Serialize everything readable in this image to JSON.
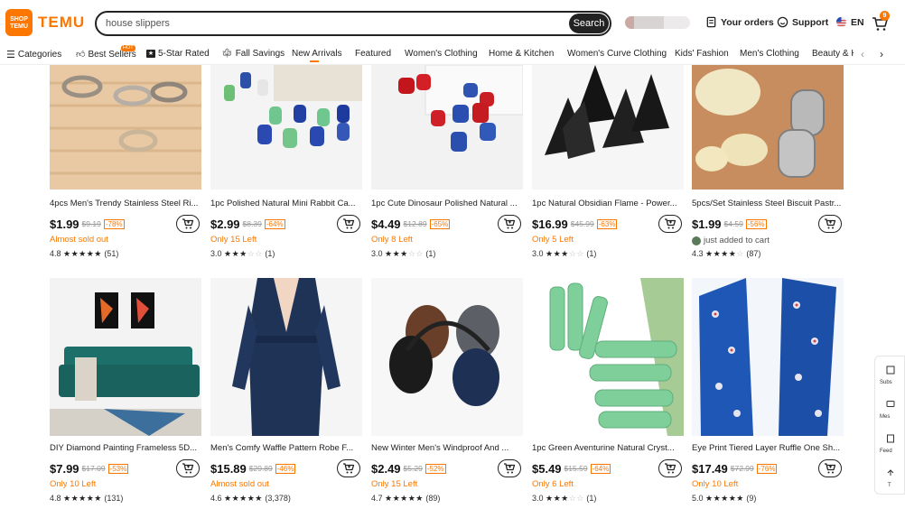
{
  "header": {
    "logo_badge": "SHOP TEMU",
    "logo_text": "TEMU",
    "search_value": "house slippers",
    "search_button": "Search",
    "your_orders": "Your orders",
    "support": "Support",
    "language": "EN",
    "cart_count": "9"
  },
  "nav": {
    "categories": "Categories",
    "best_sellers": "Best Sellers",
    "hot_badge": "HOT",
    "five_star": "5-Star Rated",
    "fall_savings": "Fall Savings",
    "new_arrivals": "New Arrivals",
    "featured": "Featured",
    "womens_clothing": "Women's Clothing",
    "home_kitchen": "Home & Kitchen",
    "womens_curve": "Women's Curve Clothing",
    "kids_fashion": "Kids' Fashion",
    "mens_clothing": "Men's Clothing",
    "beauty": "Beauty & H"
  },
  "products": [
    {
      "title": "4pcs Men's Trendy Stainless Steel Ri...",
      "price": "$1.99",
      "orig": "$9.19",
      "disc": "-78%",
      "status": "Almost sold out",
      "rating": "4.8",
      "full": 5,
      "reviews": "(51)"
    },
    {
      "title": "1pc Polished Natural Mini Rabbit Ca...",
      "price": "$2.99",
      "orig": "$8.39",
      "disc": "-64%",
      "status": "Only 15 Left",
      "rating": "3.0",
      "full": 3,
      "reviews": "(1)"
    },
    {
      "title": "1pc Cute Dinosaur Polished Natural ...",
      "price": "$4.49",
      "orig": "$12.89",
      "disc": "-65%",
      "status": "Only 8 Left",
      "rating": "3.0",
      "full": 3,
      "reviews": "(1)"
    },
    {
      "title": "1pc Natural Obsidian Flame - Power...",
      "price": "$16.99",
      "orig": "$45.99",
      "disc": "-63%",
      "status": "Only 5 Left",
      "rating": "3.0",
      "full": 3,
      "reviews": "(1)"
    },
    {
      "title": "5pcs/Set Stainless Steel Biscuit Pastr...",
      "price": "$1.99",
      "orig": "$4.59",
      "disc": "-56%",
      "status": "just added to cart",
      "rating": "4.3",
      "full": 4,
      "reviews": "(87)"
    },
    {
      "title": "DIY Diamond Painting Frameless 5D...",
      "price": "$7.99",
      "orig": "$17.09",
      "disc": "-53%",
      "status": "Only 10 Left",
      "rating": "4.8",
      "full": 5,
      "reviews": "(131)"
    },
    {
      "title": "Men's Comfy Waffle Pattern Robe F...",
      "price": "$15.89",
      "orig": "$29.89",
      "disc": "-46%",
      "status": "Almost sold out",
      "rating": "4.6",
      "full": 5,
      "reviews": "(3,378)"
    },
    {
      "title": "New Winter Men's Windproof And ...",
      "price": "$2.49",
      "orig": "$5.29",
      "disc": "-52%",
      "status": "Only 15 Left",
      "rating": "4.7",
      "full": 5,
      "reviews": "(89)"
    },
    {
      "title": "1pc Green Aventurine Natural Cryst...",
      "price": "$5.49",
      "orig": "$15.59",
      "disc": "-64%",
      "status": "Only 6 Left",
      "rating": "3.0",
      "full": 3,
      "reviews": "(1)"
    },
    {
      "title": "Eye Print Tiered Layer Ruffle One Sh...",
      "price": "$17.49",
      "orig": "$72.99",
      "disc": "-76%",
      "status": "Only 10 Left",
      "rating": "5.0",
      "full": 5,
      "reviews": "(9)"
    }
  ],
  "sidepanel": {
    "subscribe": "Subs",
    "messages": "Mes",
    "feedback": "Feed",
    "top": "T"
  },
  "colors": {
    "brand": "#fb7701"
  }
}
